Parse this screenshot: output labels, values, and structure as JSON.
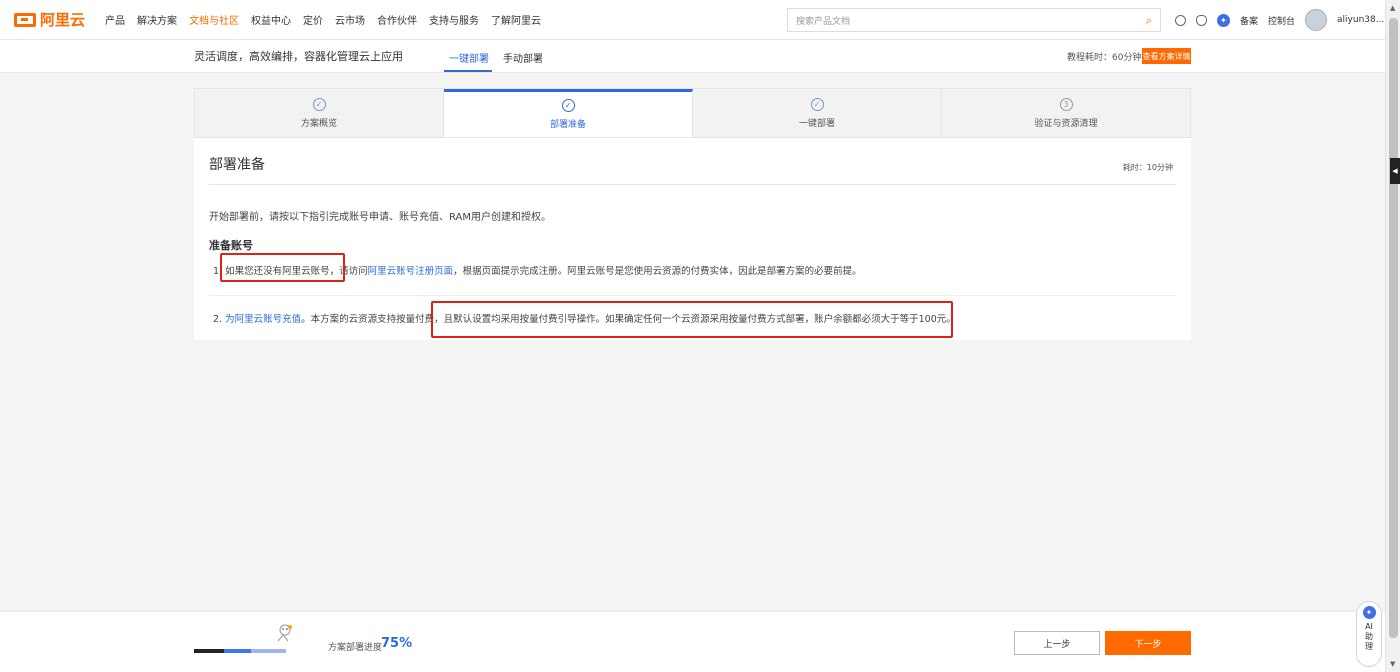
{
  "brand": {
    "name": "阿里云"
  },
  "topnav": {
    "items": [
      {
        "label": "产品",
        "active": false
      },
      {
        "label": "解决方案",
        "active": false
      },
      {
        "label": "文档与社区",
        "active": true
      },
      {
        "label": "权益中心",
        "active": false
      },
      {
        "label": "定价",
        "active": false
      },
      {
        "label": "云市场",
        "active": false
      },
      {
        "label": "合作伙伴",
        "active": false
      },
      {
        "label": "支持与服务",
        "active": false
      },
      {
        "label": "了解阿里云",
        "active": false
      }
    ],
    "search_placeholder": "搜索产品文档",
    "beian": "备案",
    "console": "控制台",
    "username": "aliyun38..."
  },
  "subhead": {
    "slogan": "灵活调度，高效编排，容器化管理云上应用",
    "tab_one_click": "一键部署",
    "tab_manual": "手动部署",
    "duration": "教程耗时：60分钟",
    "detail_button": "查看方案详情"
  },
  "steps": [
    {
      "label": "方案概览",
      "icon": "✓",
      "state": "done"
    },
    {
      "label": "部署准备",
      "icon": "✓",
      "state": "active"
    },
    {
      "label": "一键部署",
      "icon": "✓",
      "state": "done"
    },
    {
      "label": "验证与资源清理",
      "icon": "3",
      "state": "todo"
    }
  ],
  "card": {
    "title": "部署准备",
    "time": "耗时：10分钟",
    "intro": "开始部署前，请按以下指引完成账号申请、账号充值、RAM用户创建和授权。",
    "section_title": "准备账号",
    "item1": {
      "prefix": "1. 如果您还没有阿里云账号，请访问",
      "link": "阿里云账号注册页面",
      "suffix": "，根据页面提示完成注册。阿里云账号是您使用云资源的付费实体，因此是部署方案的必要前提。"
    },
    "item2": {
      "prefix": "2. ",
      "link": "为阿里云账号充值",
      "suffix": "。本方案的云资源支持按量付费，且默认设置均采用按量付费引导操作。如果确定任何一个云资源采用按量付费方式部署，账户余额都必须大于等于100元。"
    }
  },
  "bottom": {
    "progress_label": "方案部署进度",
    "progress_value": "75%",
    "progress_fraction": 0.75,
    "prev_button": "上一步",
    "next_button": "下一步"
  },
  "ai_assistant": {
    "label": "AI助理"
  },
  "colors": {
    "brand": "#ff6a00",
    "link": "#2f6bd8",
    "highlight": "#e0201c"
  }
}
